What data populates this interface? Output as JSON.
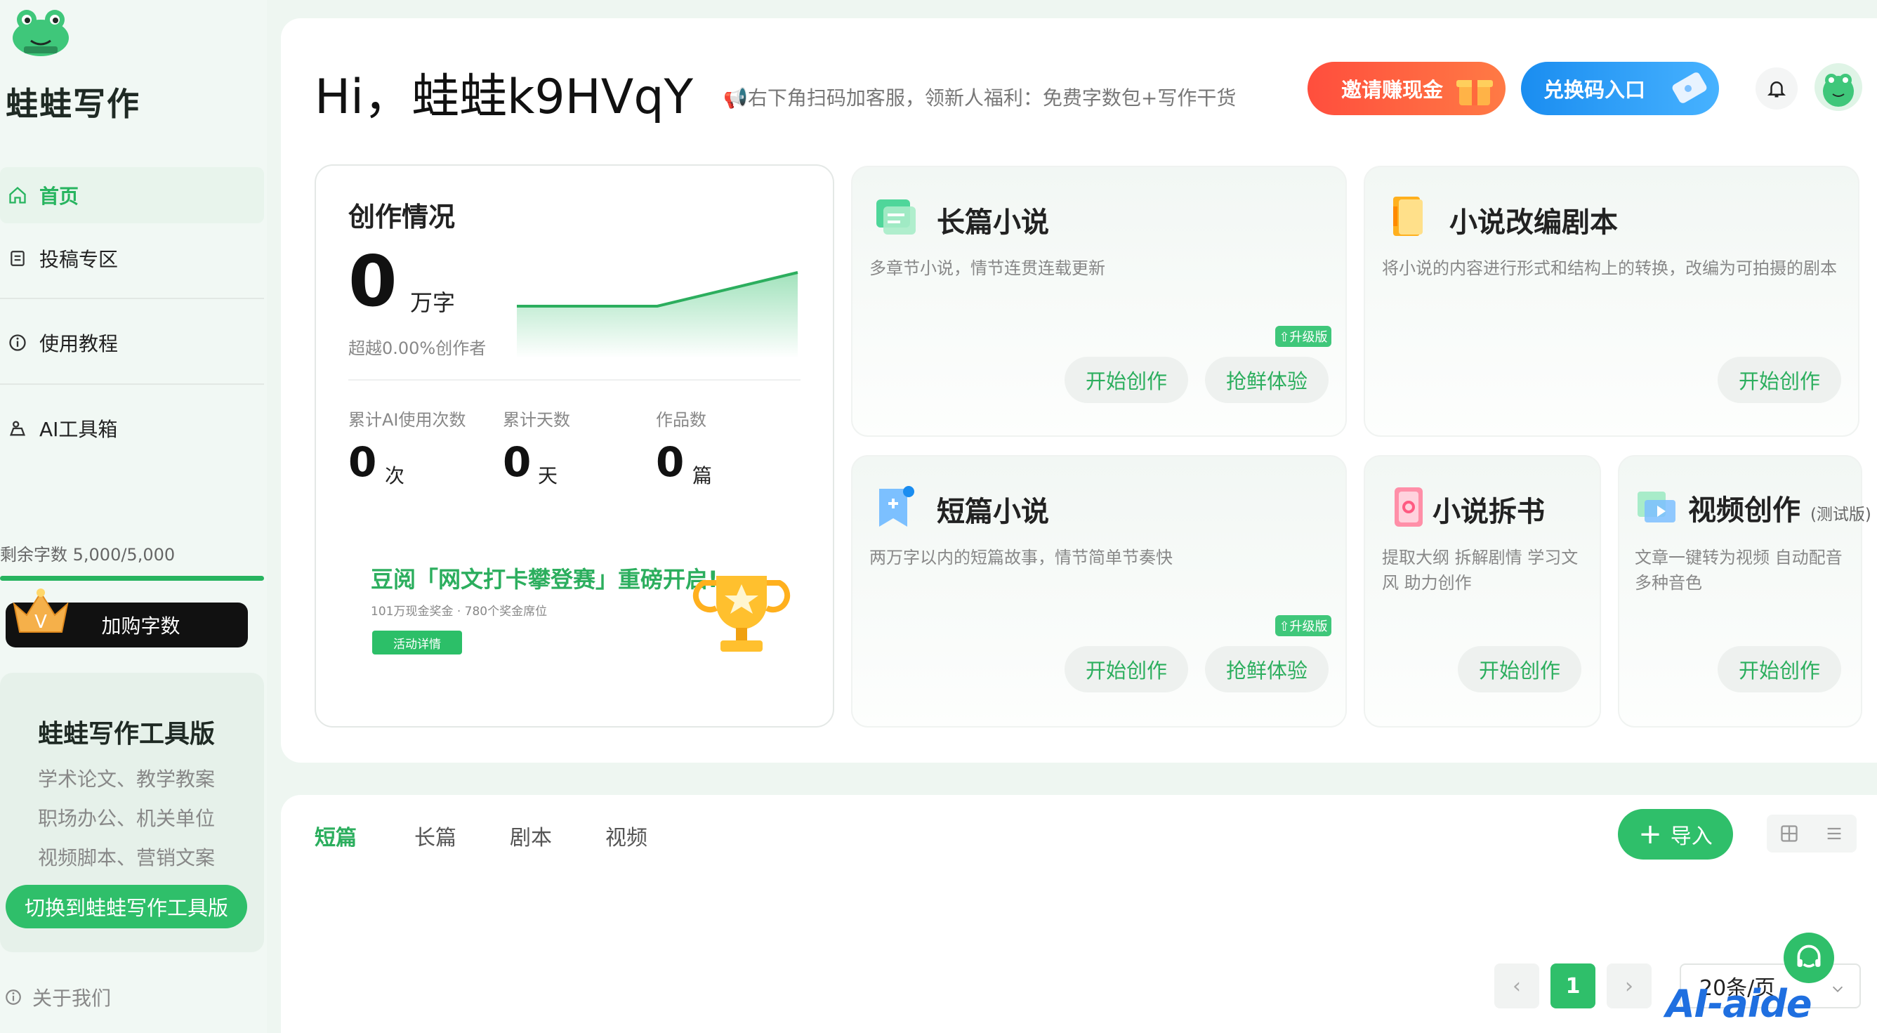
{
  "sidebar": {
    "brand": "蛙蛙写作",
    "nav": [
      {
        "label": "首页",
        "icon": "home-icon"
      },
      {
        "label": "投稿专区",
        "icon": "document-icon"
      },
      {
        "label": "使用教程",
        "icon": "info-icon"
      },
      {
        "label": "AI工具箱",
        "icon": "toolbox-icon"
      }
    ],
    "quota_text": "剩余字数 5,000/5,000",
    "quota_fraction": 1.0,
    "buy_label": "加购字数",
    "tool_card": {
      "title": "蛙蛙写作工具版",
      "lines": [
        "学术论文、教学教案",
        "职场办公、机关单位",
        "视频脚本、营销文案"
      ],
      "switch_label": "切换到蛙蛙写作工具版"
    },
    "about_label": "关于我们"
  },
  "header": {
    "greeting": "Hi，蛙蛙k9HVqY",
    "notice": "📢右下角扫码加客服，领新人福利：免费字数包+写作干货",
    "invite_label": "邀请赚现金",
    "redeem_label": "兑换码入口"
  },
  "stats": {
    "title": "创作情况",
    "words": "0",
    "words_unit": "万字",
    "rank_text": "超越0.00%创作者",
    "items": [
      {
        "label": "累计AI使用次数",
        "value": "0",
        "unit": "次"
      },
      {
        "label": "累计天数",
        "value": "0",
        "unit": "天"
      },
      {
        "label": "作品数",
        "value": "0",
        "unit": "篇"
      }
    ],
    "banner": {
      "title": "豆阅「网文打卡攀登赛」重磅开启!",
      "sub": "101万现金奖金 · 780个奖金席位",
      "button": "活动详情"
    }
  },
  "features": {
    "long_novel": {
      "title": "长篇小说",
      "desc": "多章节小说，情节连贯连载更新",
      "start": "开始创作",
      "try": "抢鲜体验",
      "badge": "升级版"
    },
    "adapt": {
      "title": "小说改编剧本",
      "desc": "将小说的内容进行形式和结构上的转换，改编为可拍摄的剧本",
      "start": "开始创作"
    },
    "short_novel": {
      "title": "短篇小说",
      "desc": "两万字以内的短篇故事，情节简单节奏快",
      "start": "开始创作",
      "try": "抢鲜体验",
      "badge": "升级版"
    },
    "breakdown": {
      "title": "小说拆书",
      "desc1": "提取大纲 拆解剧情 学习文",
      "desc2": "风 助力创作",
      "start": "开始创作"
    },
    "video": {
      "title": "视频创作",
      "tag": "(测试版)",
      "desc1": "文章一键转为视频 自动配音",
      "desc2": "多种音色",
      "start": "开始创作"
    }
  },
  "works": {
    "tabs": [
      "短篇",
      "长篇",
      "剧本",
      "视频"
    ],
    "import_label": "导入",
    "pagination": {
      "prev": "‹",
      "current": "1",
      "next": "›",
      "per_page": "20条/页"
    }
  },
  "watermark": "AI-aide",
  "colors": {
    "accent": "#2fbf6a",
    "invite": "#ff5a3d",
    "redeem": "#1a8df0"
  }
}
